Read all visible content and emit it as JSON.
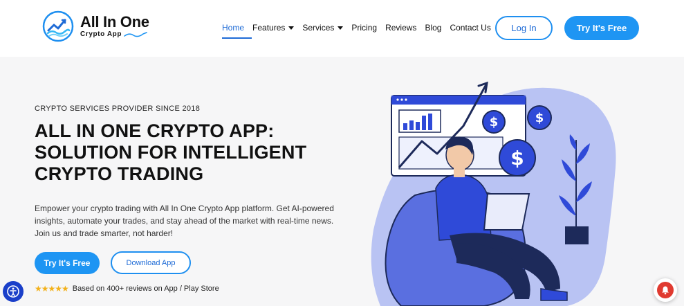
{
  "brand": {
    "title": "All In One",
    "subtitle": "Crypto App"
  },
  "nav": {
    "items": [
      {
        "label": "Home",
        "active": true,
        "dropdown": false
      },
      {
        "label": "Features",
        "active": false,
        "dropdown": true
      },
      {
        "label": "Services",
        "active": false,
        "dropdown": true
      },
      {
        "label": "Pricing",
        "active": false,
        "dropdown": false
      },
      {
        "label": "Reviews",
        "active": false,
        "dropdown": false
      },
      {
        "label": "Blog",
        "active": false,
        "dropdown": false
      },
      {
        "label": "Contact Us",
        "active": false,
        "dropdown": false
      }
    ],
    "login_label": "Log In",
    "try_label": "Try It's Free"
  },
  "hero": {
    "eyebrow": "CRYPTO SERVICES PROVIDER SINCE 2018",
    "headline_lines": [
      "ALL IN ONE CRYPTO APP:",
      "SOLUTION FOR INTELLIGENT",
      "CRYPTO TRADING"
    ],
    "description": "Empower your crypto trading with All In One Crypto App platform. Get AI-powered insights, automate your trades, and stay ahead of the market with real-time news. Join us and trade smarter, not harder!",
    "try_label": "Try It's Free",
    "download_label": "Download App",
    "stars": "★★★★★",
    "reviews_text": "Based on 400+ reviews on App / Play Store"
  },
  "colors": {
    "accent": "#1e95f3",
    "accent_dark": "#1e6bd6",
    "illustration_blue": "#2f4ad8",
    "illustration_light": "#b9c3f3",
    "star": "#f3b11a",
    "alert_red": "#e03a30"
  },
  "icons": {
    "logo": "wave-chart-logo-icon",
    "accessibility": "accessibility-icon",
    "notification": "bell-icon",
    "dollar": "dollar-coin-icon"
  }
}
